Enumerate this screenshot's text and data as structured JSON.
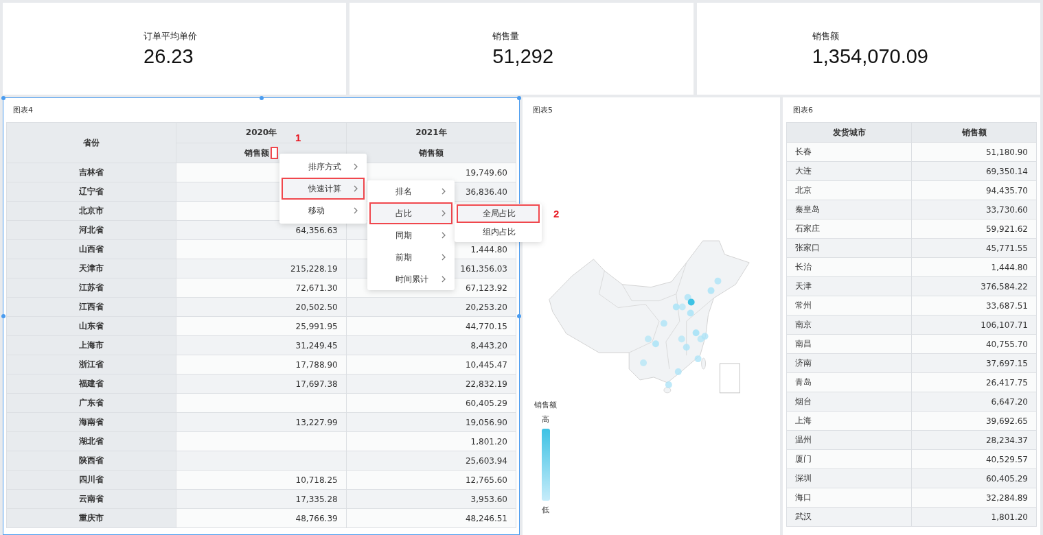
{
  "kpis": [
    {
      "label": "订单平均单价",
      "value": "26.23"
    },
    {
      "label": "销售量",
      "value": "51,292"
    },
    {
      "label": "销售额",
      "value": "1,354,070.09"
    }
  ],
  "pivot_table": {
    "title": "图表4",
    "selected": true,
    "row_header": "省份",
    "years": [
      "2020年",
      "2021年"
    ],
    "measures": [
      {
        "label": "销售额",
        "marked": true
      },
      {
        "label": "销售额",
        "marked": false
      }
    ],
    "rows": [
      {
        "province": "吉林省",
        "year_2021": "19,749.60"
      },
      {
        "province": "辽宁省",
        "year_2021": "36,836.40"
      },
      {
        "province": "北京市"
      },
      {
        "province": "河北省",
        "year_2020": "64,356.63"
      },
      {
        "province": "山西省",
        "year_2021": "1,444.80"
      },
      {
        "province": "天津市",
        "year_2020": "215,228.19",
        "year_2021": "161,356.03"
      },
      {
        "province": "江苏省",
        "year_2020": "72,671.30",
        "year_2021": "67,123.92"
      },
      {
        "province": "江西省",
        "year_2020": "20,502.50",
        "year_2021": "20,253.20"
      },
      {
        "province": "山东省",
        "year_2020": "25,991.95",
        "year_2021": "44,770.15"
      },
      {
        "province": "上海市",
        "year_2020": "31,249.45",
        "year_2021": "8,443.20"
      },
      {
        "province": "浙江省",
        "year_2020": "17,788.90",
        "year_2021": "10,445.47"
      },
      {
        "province": "福建省",
        "year_2020": "17,697.38",
        "year_2021": "22,832.19"
      },
      {
        "province": "广东省",
        "year_2021": "60,405.29"
      },
      {
        "province": "海南省",
        "year_2020": "13,227.99",
        "year_2021": "19,056.90"
      },
      {
        "province": "湖北省",
        "year_2021": "1,801.20"
      },
      {
        "province": "陕西省",
        "year_2021": "25,603.94"
      },
      {
        "province": "四川省",
        "year_2020": "10,718.25",
        "year_2021": "12,765.60"
      },
      {
        "province": "云南省",
        "year_2020": "17,335.28",
        "year_2021": "3,953.60"
      },
      {
        "province": "重庆市",
        "year_2020": "48,766.39",
        "year_2021": "48,246.51"
      }
    ]
  },
  "menus": [
    {
      "items": [
        {
          "label": "排序方式",
          "selected": false,
          "has_submenu": true
        },
        {
          "label": "快速计算",
          "selected": true,
          "has_submenu": true
        },
        {
          "label": "移动",
          "selected": false,
          "has_submenu": true
        }
      ]
    },
    {
      "items": [
        {
          "label": "排名",
          "selected": false,
          "has_submenu": true
        },
        {
          "label": "占比",
          "selected": true,
          "has_submenu": true
        },
        {
          "label": "同期",
          "selected": false,
          "has_submenu": true
        },
        {
          "label": "前期",
          "selected": false,
          "has_submenu": true
        },
        {
          "label": "时间累计",
          "selected": false,
          "has_submenu": true
        }
      ]
    },
    {
      "items": [
        {
          "label": "全局占比",
          "selected": true,
          "has_submenu": false
        },
        {
          "label": "组内占比",
          "selected": false,
          "has_submenu": false
        }
      ]
    }
  ],
  "callouts": [
    "1",
    "2"
  ],
  "map_chart": {
    "title": "图表5",
    "legend": {
      "title": "销售额",
      "high": "高",
      "low": "低"
    }
  },
  "city_table": {
    "title": "图表6",
    "columns": [
      "发货城市",
      "销售额"
    ],
    "rows": [
      [
        "长春",
        "51,180.90"
      ],
      [
        "大连",
        "69,350.14"
      ],
      [
        "北京",
        "94,435.70"
      ],
      [
        "秦皇岛",
        "33,730.60"
      ],
      [
        "石家庄",
        "59,921.62"
      ],
      [
        "张家口",
        "45,771.55"
      ],
      [
        "长治",
        "1,444.80"
      ],
      [
        "天津",
        "376,584.22"
      ],
      [
        "常州",
        "33,687.51"
      ],
      [
        "南京",
        "106,107.71"
      ],
      [
        "南昌",
        "40,755.70"
      ],
      [
        "济南",
        "37,697.15"
      ],
      [
        "青岛",
        "26,417.75"
      ],
      [
        "烟台",
        "6,647.20"
      ],
      [
        "上海",
        "39,692.65"
      ],
      [
        "温州",
        "28,234.37"
      ],
      [
        "厦门",
        "40,529.57"
      ],
      [
        "深圳",
        "60,405.29"
      ],
      [
        "海口",
        "32,284.89"
      ],
      [
        "武汉",
        "1,801.20"
      ]
    ]
  }
}
